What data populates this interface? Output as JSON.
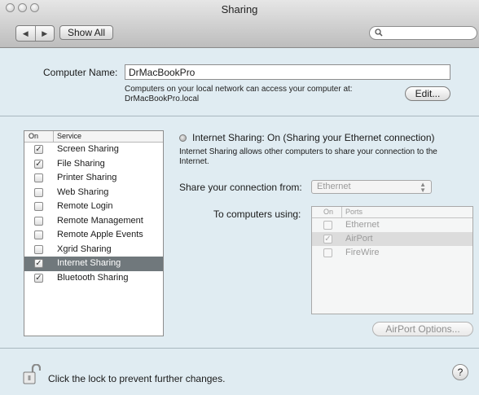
{
  "window": {
    "title": "Sharing",
    "show_all_label": "Show All",
    "nav_back": "◀",
    "nav_forward": "▶",
    "search_placeholder": ""
  },
  "computer_name": {
    "label": "Computer Name:",
    "value": "DrMacBookPro",
    "note_line1": "Computers on your local network can access your computer at:",
    "note_line2": "DrMacBookPro.local",
    "edit_label": "Edit..."
  },
  "services": {
    "header_on": "On",
    "header_service": "Service",
    "items": [
      {
        "label": "Screen Sharing",
        "checked": true,
        "selected": false
      },
      {
        "label": "File Sharing",
        "checked": true,
        "selected": false
      },
      {
        "label": "Printer Sharing",
        "checked": false,
        "selected": false
      },
      {
        "label": "Web Sharing",
        "checked": false,
        "selected": false
      },
      {
        "label": "Remote Login",
        "checked": false,
        "selected": false
      },
      {
        "label": "Remote Management",
        "checked": false,
        "selected": false
      },
      {
        "label": "Remote Apple Events",
        "checked": false,
        "selected": false
      },
      {
        "label": "Xgrid Sharing",
        "checked": false,
        "selected": false
      },
      {
        "label": "Internet Sharing",
        "checked": true,
        "selected": true
      },
      {
        "label": "Bluetooth Sharing",
        "checked": true,
        "selected": false
      }
    ]
  },
  "detail": {
    "status": "Internet Sharing: On (Sharing your Ethernet connection)",
    "description": "Internet Sharing allows other computers to share your connection to the Internet.",
    "share_from_label": "Share your connection from:",
    "share_from_value": "Ethernet",
    "to_computers_label": "To computers using:",
    "ports_header_on": "On",
    "ports_header_ports": "Ports",
    "ports": [
      {
        "label": "Ethernet",
        "checked": false
      },
      {
        "label": "AirPort",
        "checked": true
      },
      {
        "label": "FireWire",
        "checked": false
      }
    ],
    "airport_options_label": "AirPort Options..."
  },
  "footer": {
    "lock_text": "Click the lock to prevent further changes.",
    "help_label": "?"
  },
  "colors": {
    "pane_background": "#e0ecf2",
    "selection": "#70787c"
  }
}
